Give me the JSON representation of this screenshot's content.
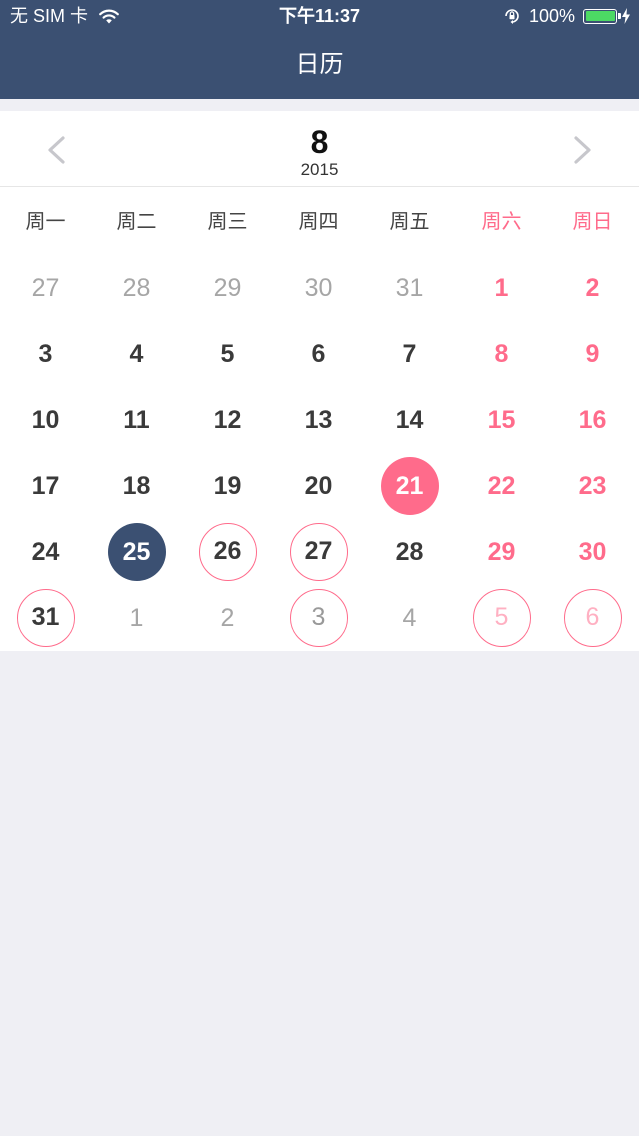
{
  "status_bar": {
    "carrier": "无 SIM 卡",
    "time": "下午11:37",
    "battery": "100%",
    "battery_level": 1.0,
    "icons": [
      "wifi-icon",
      "orientation-lock-icon",
      "battery-icon",
      "charging-bolt-icon"
    ]
  },
  "nav": {
    "title": "日历"
  },
  "month_header": {
    "month": "8",
    "year": "2015",
    "prev_icon": "chevron-left-icon",
    "next_icon": "chevron-right-icon"
  },
  "weekdays": [
    "周一",
    "周二",
    "周三",
    "周四",
    "周五",
    "周六",
    "周日"
  ],
  "weeks": [
    [
      {
        "label": "27",
        "other": true
      },
      {
        "label": "28",
        "other": true
      },
      {
        "label": "29",
        "other": true
      },
      {
        "label": "30",
        "other": true
      },
      {
        "label": "31",
        "other": true
      },
      {
        "label": "1",
        "weekend": true
      },
      {
        "label": "2",
        "weekend": true
      }
    ],
    [
      {
        "label": "3"
      },
      {
        "label": "4"
      },
      {
        "label": "5"
      },
      {
        "label": "6"
      },
      {
        "label": "7"
      },
      {
        "label": "8",
        "weekend": true
      },
      {
        "label": "9",
        "weekend": true
      }
    ],
    [
      {
        "label": "10"
      },
      {
        "label": "11"
      },
      {
        "label": "12"
      },
      {
        "label": "13"
      },
      {
        "label": "14"
      },
      {
        "label": "15",
        "weekend": true
      },
      {
        "label": "16",
        "weekend": true
      }
    ],
    [
      {
        "label": "17"
      },
      {
        "label": "18"
      },
      {
        "label": "19"
      },
      {
        "label": "20"
      },
      {
        "label": "21",
        "today": true
      },
      {
        "label": "22",
        "weekend": true
      },
      {
        "label": "23",
        "weekend": true
      }
    ],
    [
      {
        "label": "24"
      },
      {
        "label": "25",
        "selected": true
      },
      {
        "label": "26",
        "marked": true
      },
      {
        "label": "27",
        "marked": true
      },
      {
        "label": "28"
      },
      {
        "label": "29",
        "weekend": true
      },
      {
        "label": "30",
        "weekend": true
      }
    ],
    [
      {
        "label": "31",
        "marked": true
      },
      {
        "label": "1",
        "other": true
      },
      {
        "label": "2",
        "other": true
      },
      {
        "label": "3",
        "other": true,
        "marked": true
      },
      {
        "label": "4",
        "other": true
      },
      {
        "label": "5",
        "other": true,
        "weekend": true,
        "marked": true
      },
      {
        "label": "6",
        "other": true,
        "weekend": true,
        "marked": true
      }
    ]
  ],
  "colors": {
    "nav_background": "#3b5072",
    "accent_pink": "#ff6b8b",
    "selected_day": "#3b5072",
    "page_background": "#efeff4"
  }
}
